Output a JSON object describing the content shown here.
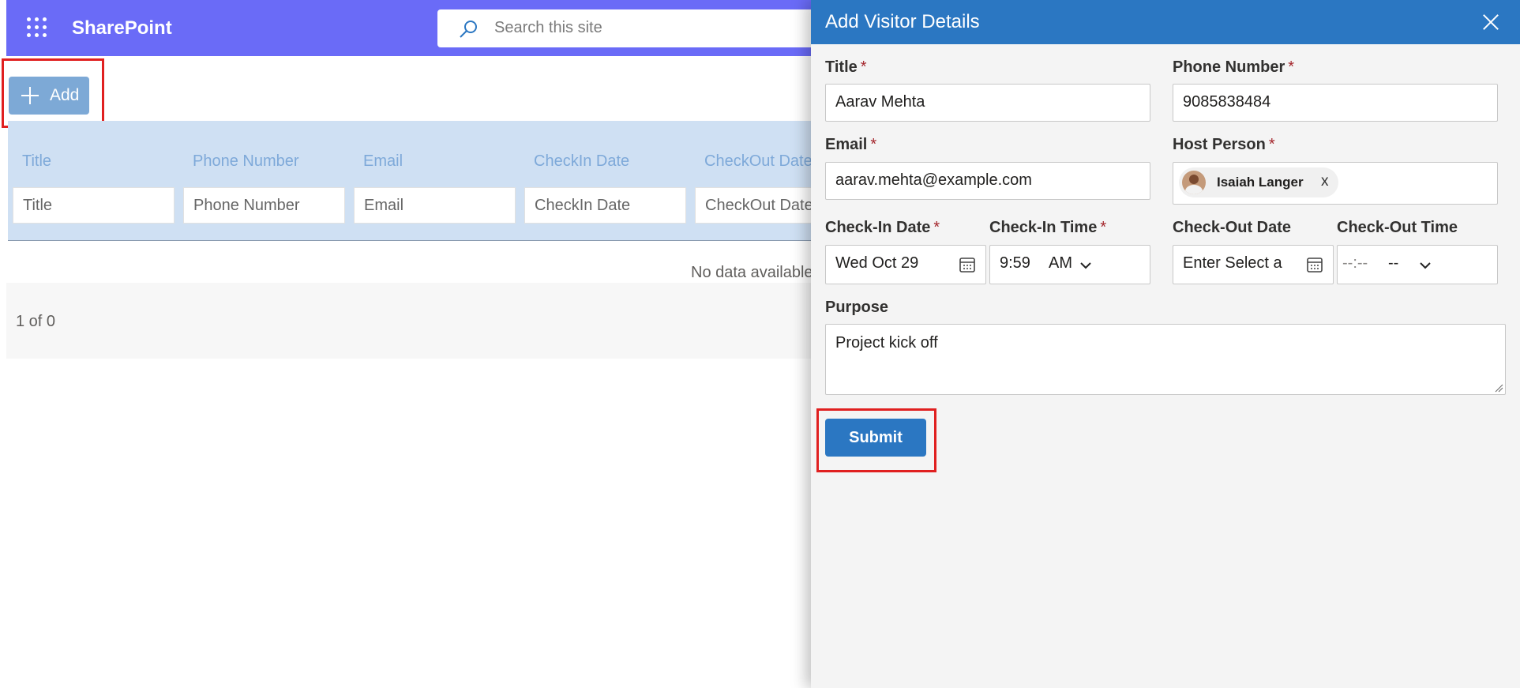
{
  "suitebar": {
    "brand": "SharePoint",
    "search_placeholder": "Search this site"
  },
  "toolbar": {
    "add_label": "Add"
  },
  "table": {
    "columns": [
      "Title",
      "Phone Number",
      "Email",
      "CheckIn Date",
      "CheckOut Date"
    ],
    "filter_placeholders": [
      "Title",
      "Phone Number",
      "Email",
      "CheckIn Date",
      "CheckOut Date"
    ],
    "empty_text": "No data available",
    "pager_text": "1 of 0"
  },
  "panel": {
    "title": "Add Visitor Details",
    "required_mark": "*",
    "fields": {
      "title": {
        "label": "Title",
        "value": "Aarav Mehta"
      },
      "phone": {
        "label": "Phone Number",
        "value": "9085838484"
      },
      "email": {
        "label": "Email",
        "value": "aarav.mehta@example.com"
      },
      "host": {
        "label": "Host Person",
        "person": "Isaiah Langer",
        "remove": "x"
      },
      "checkin_date": {
        "label": "Check-In Date",
        "value": "Wed Oct 29"
      },
      "checkin_time": {
        "label": "Check-In Time",
        "value": "9:59",
        "ampm": "AM"
      },
      "checkout_date": {
        "label": "Check-Out Date",
        "placeholder": "Enter Select a"
      },
      "checkout_time": {
        "label": "Check-Out Time",
        "value": "--:--",
        "ampm": "--"
      },
      "purpose": {
        "label": "Purpose",
        "value": "Project kick off"
      }
    },
    "submit_label": "Submit"
  },
  "colors": {
    "suitebar": "#6a6bf7",
    "panel_header": "#2b77c2",
    "add_button": "#7da9d6",
    "table_header": "#cfe0f3",
    "highlight": "#e02020"
  }
}
